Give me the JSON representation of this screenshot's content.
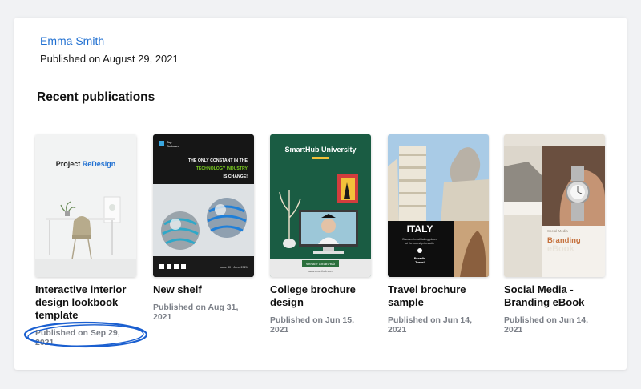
{
  "author": {
    "name": "Emma Smith",
    "published": "Published on August 29, 2021"
  },
  "recent": {
    "heading": "Recent publications",
    "items": [
      {
        "title": "Interactive interior design lookbook template",
        "date": "Published on Sep 29, 2021",
        "cover": {
          "heading_part1": "Project ",
          "heading_part2": "ReDesign"
        }
      },
      {
        "title": "New shelf",
        "date": "Published on Aug 31, 2021",
        "cover": {
          "brand_line1": "Top",
          "brand_line2": "Software",
          "line1": "THE ONLY CONSTANT IN THE",
          "line2": "TECHNOLOGY INDUSTRY",
          "line3": "IS CHANGE!",
          "footer": "Issue 80 | June 2021"
        }
      },
      {
        "title": "College brochure design",
        "date": "Published on Jun 15, 2021",
        "cover": {
          "heading": "SmartHub University",
          "banner": "We are SmartHub",
          "url": "www.smarthub.com"
        }
      },
      {
        "title": "Travel brochure sample",
        "date": "Published on Jun 14, 2021",
        "cover": {
          "heading": "ITALY",
          "subtitle_line1": "Discover breathtaking places",
          "subtitle_line2": "at the lowest prices with",
          "brand_line1": "Paradis",
          "brand_line2": "Travel"
        }
      },
      {
        "title": "Social Media - Branding eBook",
        "date": "Published on Jun 14, 2021",
        "cover": {
          "small": "Social Media",
          "heading": "Branding",
          "ghost": "eBook"
        }
      }
    ]
  },
  "colors": {
    "link": "#1f6fd1",
    "muted": "#7c8088",
    "highlight": "#1a5fd0"
  }
}
